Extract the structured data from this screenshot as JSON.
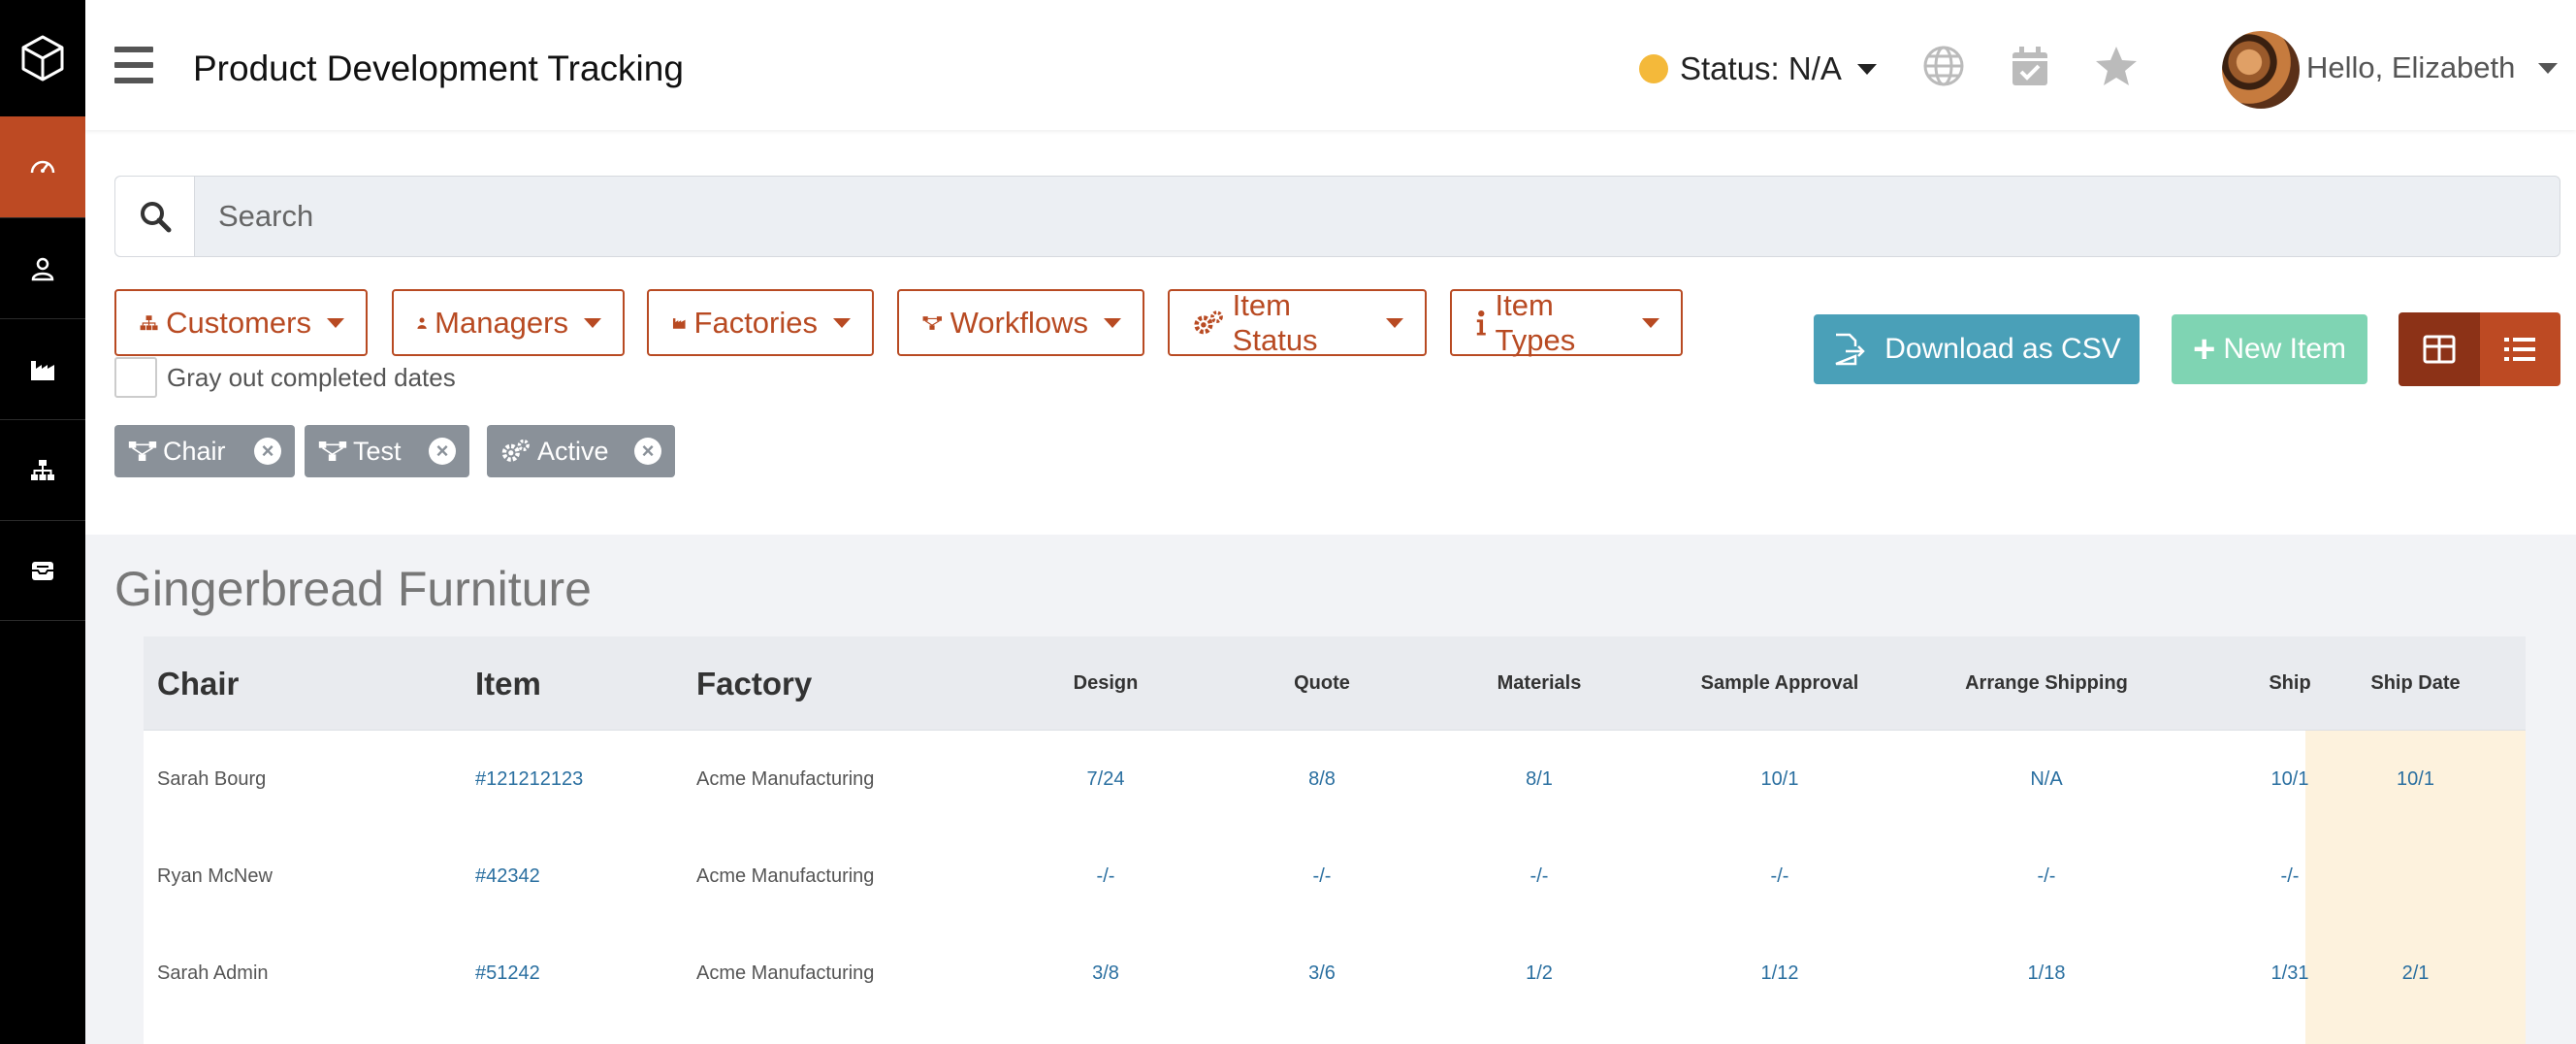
{
  "header": {
    "title": "Product Development Tracking",
    "status_label": "Status: N/A",
    "greeting": "Hello, Elizabeth"
  },
  "search": {
    "placeholder": "Search"
  },
  "filters": [
    {
      "label": "Customers"
    },
    {
      "label": "Managers"
    },
    {
      "label": "Factories"
    },
    {
      "label": "Workflows"
    },
    {
      "label": "Item Status"
    },
    {
      "label": "Item Types"
    }
  ],
  "actions": {
    "download_csv": "Download as CSV",
    "new_item": "New Item"
  },
  "gray_out_label": "Gray out completed dates",
  "chips": [
    {
      "label": "Chair"
    },
    {
      "label": "Test"
    },
    {
      "label": "Active"
    }
  ],
  "group": {
    "title": "Gingerbread Furniture",
    "columns": [
      "Chair",
      "Item",
      "Factory",
      "Design",
      "Quote",
      "Materials",
      "Sample Approval",
      "Arrange Shipping",
      "Ship",
      "Ship Date"
    ],
    "rows": [
      {
        "chair": "Sarah Bourg",
        "item": "#121212123",
        "factory": "Acme Manufacturing",
        "design": "7/24",
        "quote": "8/8",
        "materials": "8/1",
        "sample": "10/1",
        "arrange": "N/A",
        "ship": "10/1",
        "ship_date": "10/1"
      },
      {
        "chair": "Ryan McNew",
        "item": "#42342",
        "factory": "Acme Manufacturing",
        "design": "-/-",
        "quote": "-/-",
        "materials": "-/-",
        "sample": "-/-",
        "arrange": "-/-",
        "ship": "-/-",
        "ship_date": ""
      },
      {
        "chair": "Sarah Admin",
        "item": "#51242",
        "factory": "Acme Manufacturing",
        "design": "3/8",
        "quote": "3/6",
        "materials": "1/2",
        "sample": "1/12",
        "arrange": "1/18",
        "ship": "1/31",
        "ship_date": "2/1"
      }
    ]
  },
  "colors": {
    "accent": "#bd4a23",
    "csv": "#4aa0b8",
    "new": "#7fd4b3",
    "status_dot": "#f4b93a"
  }
}
